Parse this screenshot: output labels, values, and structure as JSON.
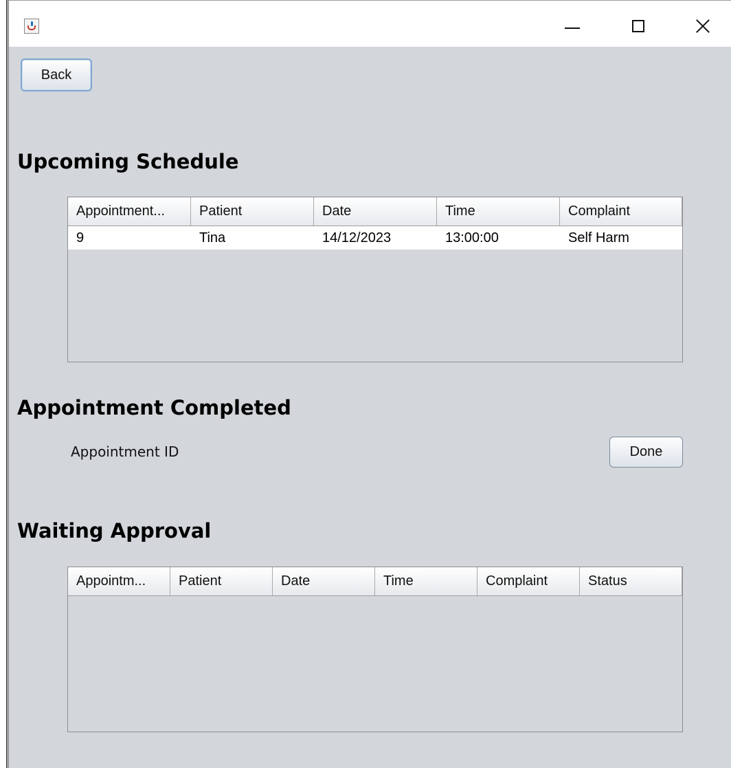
{
  "window": {
    "controls": {
      "minimize": "minimize",
      "maximize": "maximize",
      "close": "close"
    }
  },
  "toolbar": {
    "back_label": "Back"
  },
  "upcoming": {
    "heading": "Upcoming Schedule",
    "columns": [
      "Appointment...",
      "Patient",
      "Date",
      "Time",
      "Complaint"
    ],
    "rows": [
      [
        "9",
        "Tina",
        "14/12/2023",
        "13:00:00",
        "Self Harm"
      ]
    ]
  },
  "completed": {
    "heading": "Appointment Completed",
    "field_label": "Appointment ID",
    "done_label": "Done"
  },
  "waiting": {
    "heading": "Waiting Approval",
    "columns": [
      "Appointm...",
      "Patient",
      "Date",
      "Time",
      "Complaint",
      "Status"
    ],
    "rows": []
  }
}
